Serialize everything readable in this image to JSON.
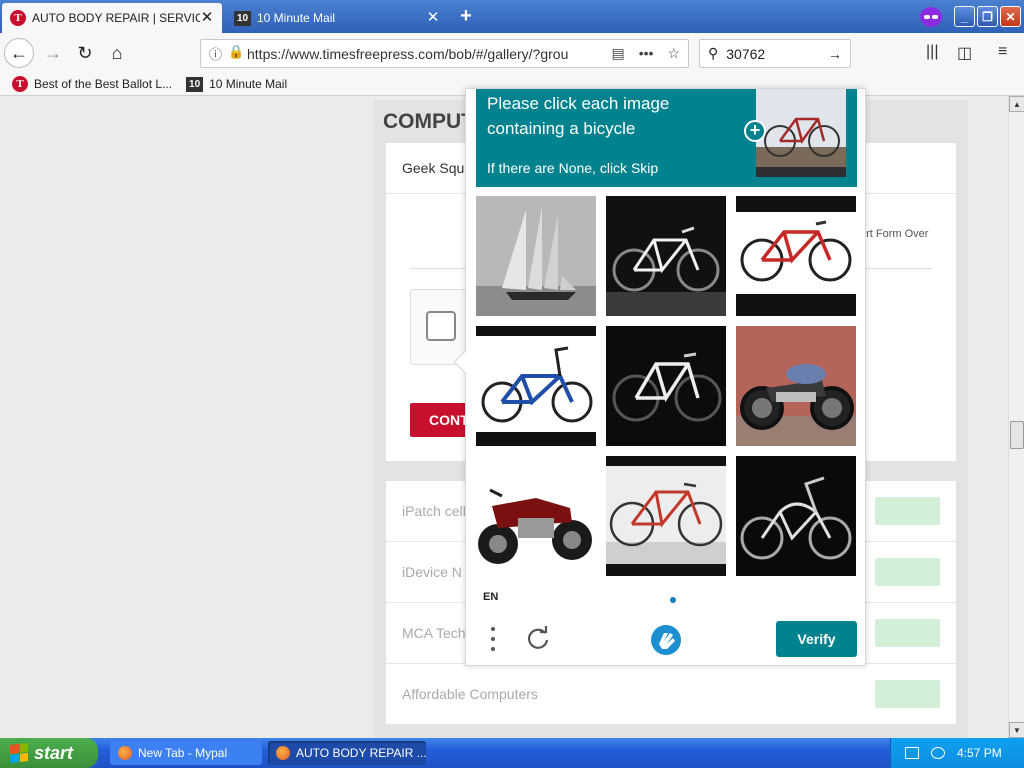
{
  "tabs": [
    {
      "title": "AUTO BODY REPAIR | SERVICES",
      "favicon": "T",
      "active": true
    },
    {
      "title": "10 Minute Mail",
      "favicon": "10",
      "active": false
    }
  ],
  "navbar": {
    "url": "https://www.timesfreepress.com/bob/#/gallery/?grou",
    "search_value": "30762"
  },
  "bookmarks": [
    {
      "label": "Best of the Best Ballot L...",
      "favicon": "T"
    },
    {
      "label": "10 Minute Mail",
      "favicon": "10"
    }
  ],
  "page": {
    "heading": "COMPUT",
    "card_header": "Geek Squ",
    "start_over": "art Form Over",
    "continue_label": "CONT",
    "listings": [
      {
        "name": "iPatch cell"
      },
      {
        "name": "iDevice N"
      },
      {
        "name": "MCA Tech"
      },
      {
        "name": "Affordable Computers"
      }
    ]
  },
  "captcha": {
    "prompt": "Please click each image containing a bicycle",
    "skip_hint": "If there are None, click Skip",
    "language": "EN",
    "verify_label": "Verify",
    "accent_color": "#00838f",
    "tiles": [
      {
        "subject": "sailboat"
      },
      {
        "subject": "bicycle"
      },
      {
        "subject": "bicycle"
      },
      {
        "subject": "bicycle"
      },
      {
        "subject": "bicycle"
      },
      {
        "subject": "motorcycle"
      },
      {
        "subject": "motorcycle"
      },
      {
        "subject": "bicycle"
      },
      {
        "subject": "bicycle"
      }
    ]
  },
  "taskbar": {
    "start_label": "start",
    "items": [
      {
        "label": "New Tab - Mypal"
      },
      {
        "label": "AUTO BODY REPAIR ..."
      }
    ],
    "clock": "4:57 PM"
  }
}
